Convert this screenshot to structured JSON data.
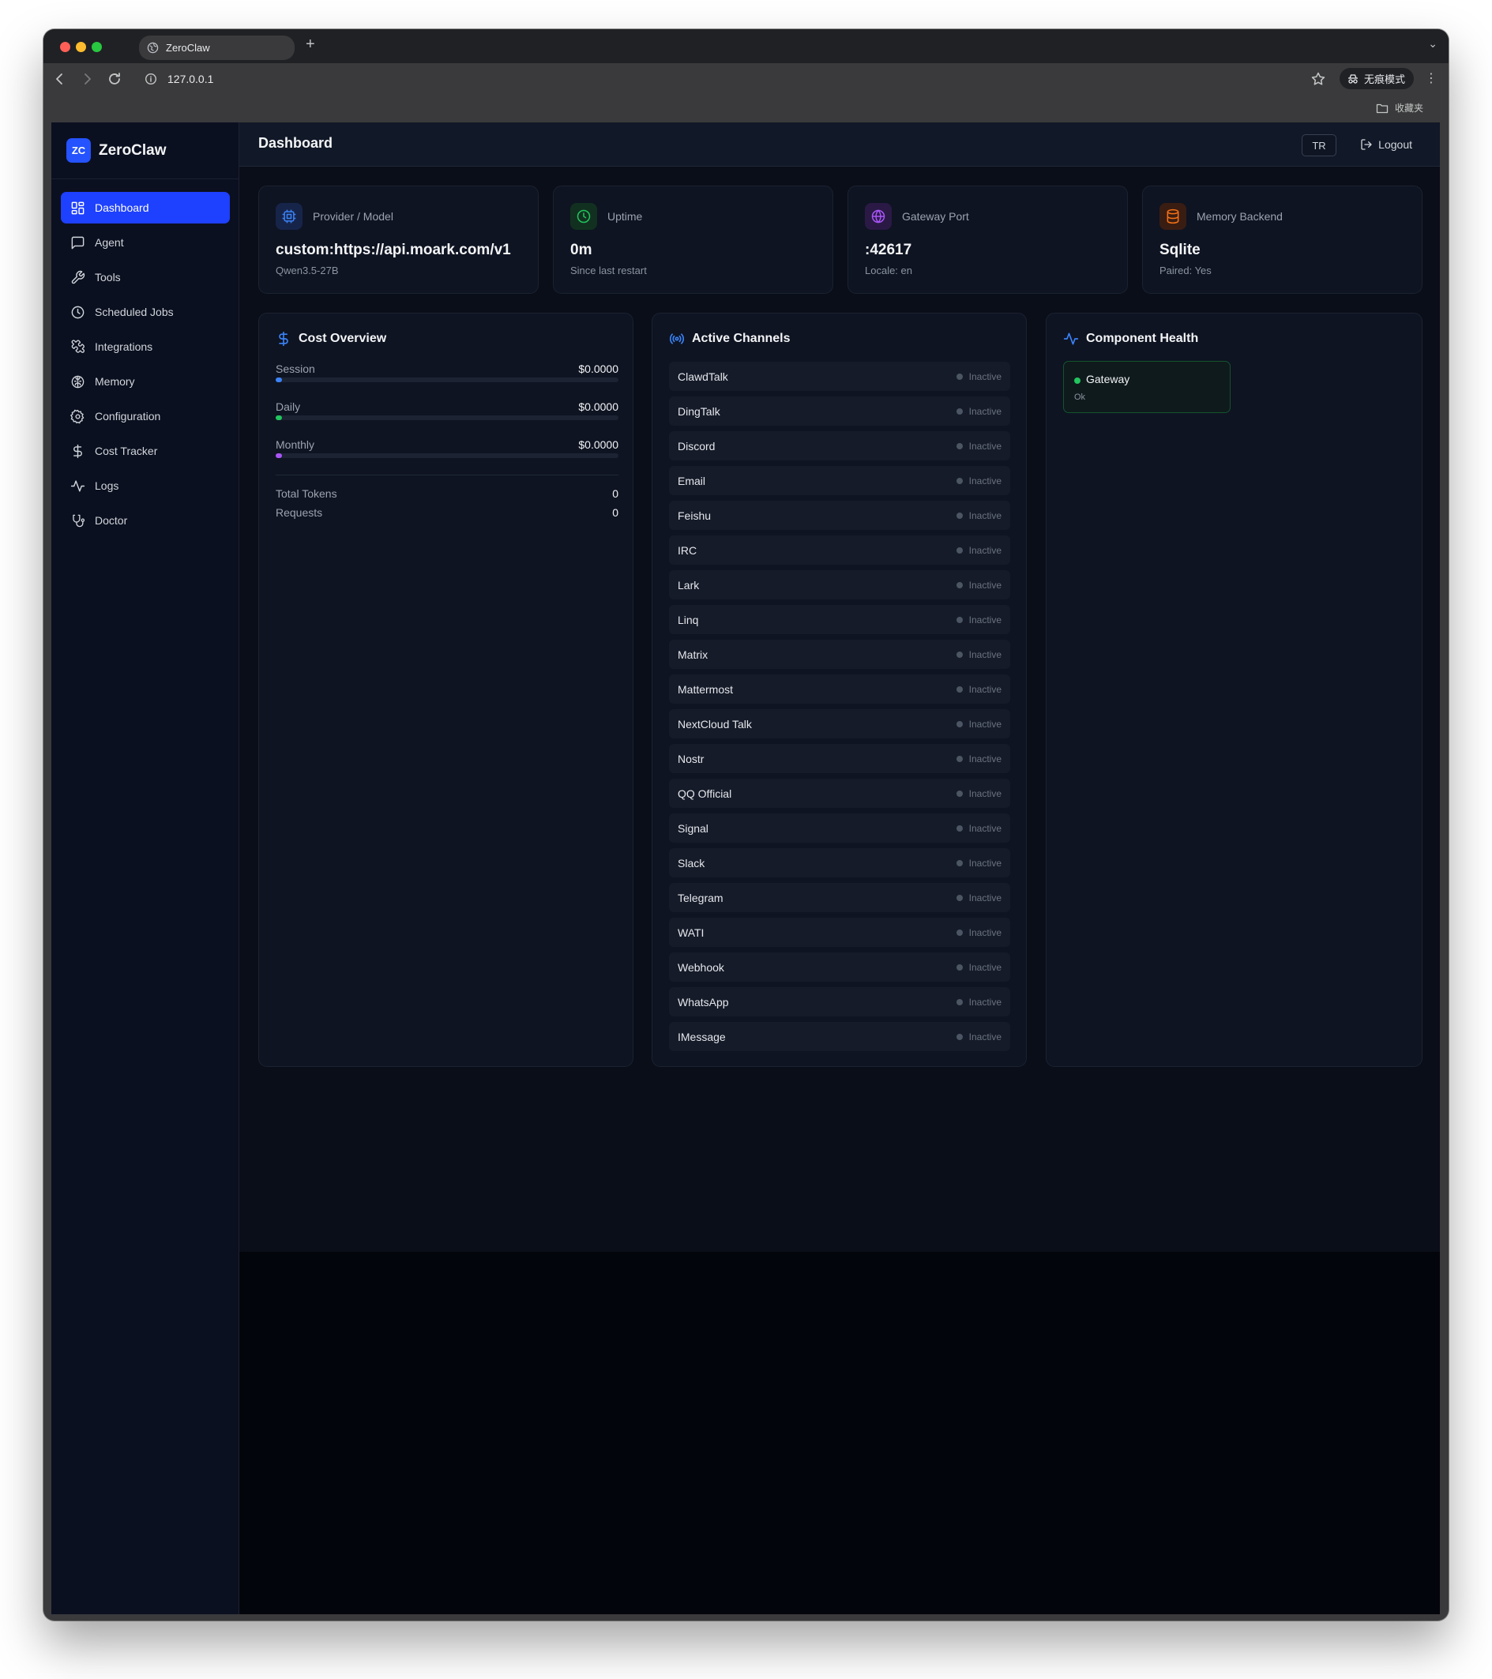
{
  "browser": {
    "tab_title": "ZeroClaw",
    "new_tab": "+",
    "tab_menu": "⌄",
    "url": "127.0.0.1",
    "incognito_label": "无痕模式",
    "kebab": "⋮",
    "bookmarks_folder": "收藏夹"
  },
  "sidebar": {
    "logo_text": "ZC",
    "brand": "ZeroClaw",
    "items": [
      {
        "label": "Dashboard",
        "icon": "layout-dashboard-icon",
        "active": true
      },
      {
        "label": "Agent",
        "icon": "message-square-icon",
        "active": false
      },
      {
        "label": "Tools",
        "icon": "wrench-icon",
        "active": false
      },
      {
        "label": "Scheduled Jobs",
        "icon": "clock-icon",
        "active": false
      },
      {
        "label": "Integrations",
        "icon": "puzzle-icon",
        "active": false
      },
      {
        "label": "Memory",
        "icon": "brain-icon",
        "active": false
      },
      {
        "label": "Configuration",
        "icon": "settings-icon",
        "active": false
      },
      {
        "label": "Cost Tracker",
        "icon": "dollar-icon",
        "active": false
      },
      {
        "label": "Logs",
        "icon": "activity-icon",
        "active": false
      },
      {
        "label": "Doctor",
        "icon": "stethoscope-icon",
        "active": false
      }
    ]
  },
  "header": {
    "title": "Dashboard",
    "lang": "TR",
    "logout": "Logout"
  },
  "stats": [
    {
      "label": "Provider / Model",
      "value": "custom:https://api.moark.com/v1",
      "sub": "Qwen3.5-27B",
      "icon": "cpu-icon",
      "color": "#3b82f6"
    },
    {
      "label": "Uptime",
      "value": "0m",
      "sub": "Since last restart",
      "icon": "clock-icon",
      "color": "#22c55e"
    },
    {
      "label": "Gateway Port",
      "value": ":42617",
      "sub": "Locale: en",
      "icon": "globe-icon",
      "color": "#a855f7"
    },
    {
      "label": "Memory Backend",
      "value": "Sqlite",
      "sub": "Paired: Yes",
      "icon": "database-icon",
      "color": "#f97316"
    }
  ],
  "cost": {
    "title": "Cost Overview",
    "rows": [
      {
        "label": "Session",
        "value": "$0.0000",
        "fraction": 0,
        "color": "#3b82f6"
      },
      {
        "label": "Daily",
        "value": "$0.0000",
        "fraction": 0,
        "color": "#22c55e"
      },
      {
        "label": "Monthly",
        "value": "$0.0000",
        "fraction": 0,
        "color": "#a855f7"
      }
    ],
    "total_tokens_label": "Total Tokens",
    "total_tokens": "0",
    "requests_label": "Requests",
    "requests": "0"
  },
  "channels": {
    "title": "Active Channels",
    "items": [
      {
        "name": "ClawdTalk",
        "status": "Inactive"
      },
      {
        "name": "DingTalk",
        "status": "Inactive"
      },
      {
        "name": "Discord",
        "status": "Inactive"
      },
      {
        "name": "Email",
        "status": "Inactive"
      },
      {
        "name": "Feishu",
        "status": "Inactive"
      },
      {
        "name": "IRC",
        "status": "Inactive"
      },
      {
        "name": "Lark",
        "status": "Inactive"
      },
      {
        "name": "Linq",
        "status": "Inactive"
      },
      {
        "name": "Matrix",
        "status": "Inactive"
      },
      {
        "name": "Mattermost",
        "status": "Inactive"
      },
      {
        "name": "NextCloud Talk",
        "status": "Inactive"
      },
      {
        "name": "Nostr",
        "status": "Inactive"
      },
      {
        "name": "QQ Official",
        "status": "Inactive"
      },
      {
        "name": "Signal",
        "status": "Inactive"
      },
      {
        "name": "Slack",
        "status": "Inactive"
      },
      {
        "name": "Telegram",
        "status": "Inactive"
      },
      {
        "name": "WATI",
        "status": "Inactive"
      },
      {
        "name": "Webhook",
        "status": "Inactive"
      },
      {
        "name": "WhatsApp",
        "status": "Inactive"
      },
      {
        "name": "IMessage",
        "status": "Inactive"
      }
    ]
  },
  "health": {
    "title": "Component Health",
    "components": [
      {
        "name": "Gateway",
        "status": "Ok"
      }
    ]
  }
}
